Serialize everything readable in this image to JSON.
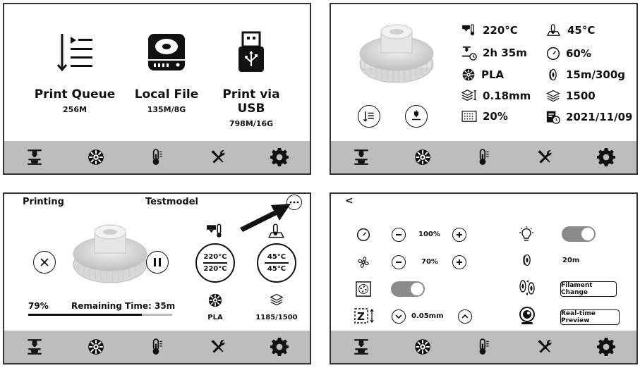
{
  "nav": {
    "items": [
      {
        "icon": "printer-icon"
      },
      {
        "icon": "filament-spool-icon"
      },
      {
        "icon": "thermometer-icon"
      },
      {
        "icon": "tools-icon"
      },
      {
        "icon": "gear-icon"
      }
    ]
  },
  "panel1": {
    "items": [
      {
        "label": "Print Queue",
        "size": "256M",
        "icon": "print-queue-icon"
      },
      {
        "label": "Local File",
        "size": "135M/8G",
        "icon": "hard-drive-icon"
      },
      {
        "label": "Print via USB",
        "size": "798M/16G",
        "icon": "usb-drive-icon"
      }
    ]
  },
  "panel2": {
    "stats": {
      "nozzle_temp": "220°C",
      "bed_temp": "45°C",
      "time": "2h 35m",
      "speed": "60%",
      "filament": "PLA",
      "filament_used": "15m/300g",
      "layer_height": "0.18mm",
      "layers": "1500",
      "infill": "20%",
      "date": "2021/11/09"
    }
  },
  "panel3": {
    "status": "Printing",
    "model_name": "Testmodel",
    "progress_label": "79%",
    "progress_value": 0.79,
    "remaining": "Remaining Time: 35m",
    "nozzle_current": "220°C",
    "nozzle_target": "220°C",
    "bed_current": "45°C",
    "bed_target": "45°C",
    "filament": "PLA",
    "layers": "1185/1500"
  },
  "panel4": {
    "back": "<",
    "speed": "100%",
    "fan": "70%",
    "z_offset": "0.05mm",
    "filament_length": "20m",
    "filament_change": "Filament Change",
    "preview": "Real-time Preview"
  },
  "colors": {
    "navbar": "#bdbdbd",
    "toggle": "#8a8a8a",
    "border": "#333333"
  }
}
